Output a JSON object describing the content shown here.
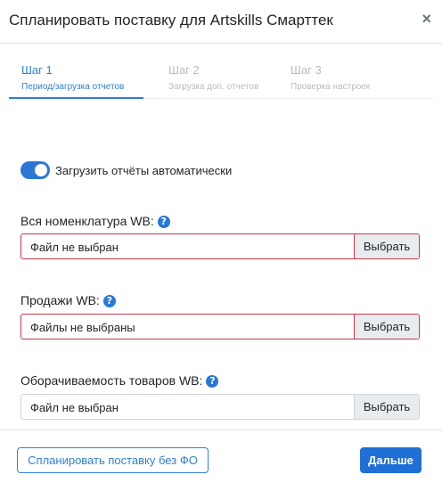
{
  "modal": {
    "title": "Спланировать поставку для Artskills Смарттек",
    "close_glyph": "×"
  },
  "steps": [
    {
      "number": "Шаг 1",
      "label": "Период/загрузка отчетов",
      "active": true
    },
    {
      "number": "Шаг 2",
      "label": "Загрузка доп. отчетов",
      "active": false
    },
    {
      "number": "Шаг 3",
      "label": "Проверка настроек",
      "active": false
    }
  ],
  "auto_upload": {
    "label": "Загрузить отчёты автоматически",
    "enabled": true
  },
  "fields": [
    {
      "label": "Вся номенклатура WB:",
      "file_text": "Файл не выбран",
      "browse_label": "Выбрать",
      "invalid": true,
      "help_icon": "question-circle-icon"
    },
    {
      "label": "Продажи WB:",
      "file_text": "Файлы не выбраны",
      "browse_label": "Выбрать",
      "invalid": true,
      "help_icon": "question-circle-icon"
    },
    {
      "label": "Оборачиваемость товаров WB:",
      "file_text": "Файл не выбран",
      "browse_label": "Выбрать",
      "invalid": false,
      "help_icon": "question-circle-icon"
    }
  ],
  "footer": {
    "secondary_button": "Спланировать поставку без ФО",
    "primary_button": "Дальше"
  },
  "colors": {
    "accent": "#2f7fd8",
    "primary_button": "#1f6fd6",
    "invalid_border": "#c8394a",
    "inactive_step": "#b6bcc2"
  }
}
